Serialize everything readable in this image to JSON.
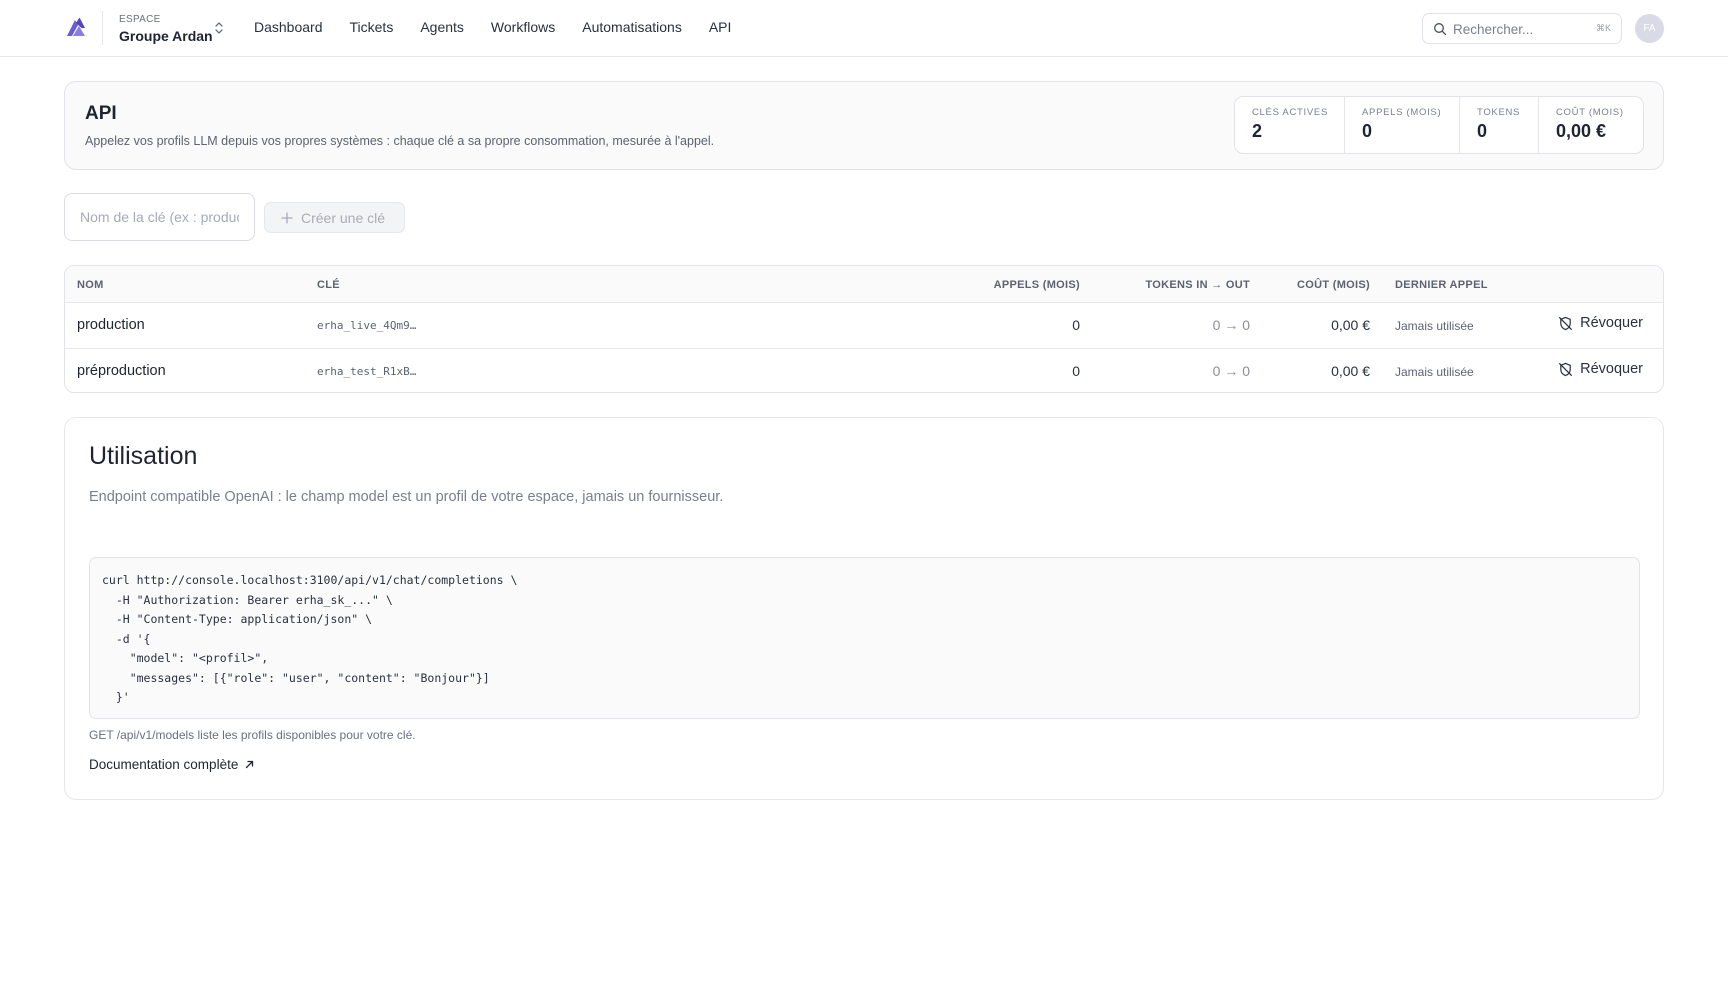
{
  "workspace": {
    "label": "ESPACE",
    "name": "Groupe Ardan"
  },
  "nav": [
    "Dashboard",
    "Tickets",
    "Agents",
    "Workflows",
    "Automatisations",
    "API"
  ],
  "search": {
    "placeholder": "Rechercher...",
    "shortcut": "⌘K"
  },
  "user": {
    "initials": "FA"
  },
  "colors": {
    "brand": "#6b5bd6",
    "avatar": "#d9dae6"
  },
  "page": {
    "title": "API",
    "subtitle": "Appelez vos profils LLM depuis vos propres systèmes : chaque clé a sa propre consommation, mesurée à l'appel."
  },
  "stats": [
    {
      "label": "Clés actives",
      "value": "2"
    },
    {
      "label": "Appels (mois)",
      "value": "0"
    },
    {
      "label": "Tokens",
      "value": "0"
    },
    {
      "label": "Coût (mois)",
      "value": "0,00 €"
    }
  ],
  "create": {
    "placeholder": "Nom de la clé (ex : production)",
    "button_label": "Créer une clé"
  },
  "table": {
    "headers": {
      "name": "Nom",
      "key": "Clé",
      "calls": "Appels (mois)",
      "tokens": "Tokens in → out",
      "cost": "Coût (mois)",
      "last": "Dernier appel"
    },
    "rows": [
      {
        "name": "production",
        "key": "erha_live_4Qm9…",
        "calls": "0",
        "tokens": "0 → 0",
        "cost": "0,00 €",
        "last": "Jamais utilisée",
        "action": "Révoquer"
      },
      {
        "name": "préproduction",
        "key": "erha_test_R1xB…",
        "calls": "0",
        "tokens": "0 → 0",
        "cost": "0,00 €",
        "last": "Jamais utilisée",
        "action": "Révoquer"
      }
    ]
  },
  "usage": {
    "title": "Utilisation",
    "subtitle": "Endpoint compatible OpenAI : le champ model est un profil de votre espace, jamais un fournisseur.",
    "code": "curl http://console.localhost:3100/api/v1/chat/completions \\\n  -H \"Authorization: Bearer erha_sk_...\" \\\n  -H \"Content-Type: application/json\" \\\n  -d '{\n    \"model\": \"<profil>\",\n    \"messages\": [{\"role\": \"user\", \"content\": \"Bonjour\"}]\n  }'",
    "note": "GET /api/v1/models liste les profils disponibles pour votre clé.",
    "doc_link": "Documentation complète"
  }
}
